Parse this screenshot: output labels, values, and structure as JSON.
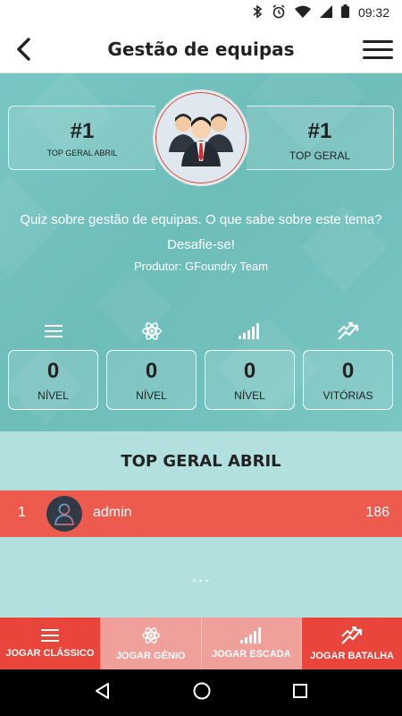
{
  "status_bar": {
    "time": "09:32",
    "icons": [
      "bluetooth-icon",
      "alarm-icon",
      "wifi-icon",
      "signal-icon",
      "battery-icon"
    ]
  },
  "app_bar": {
    "title": "Gestão de equipas",
    "back_icon": "back-arrow-icon",
    "menu_icon": "hamburger-menu-icon"
  },
  "quiz": {
    "rank_month": {
      "value": "#1",
      "label": "TOP GERAL ABRIL"
    },
    "rank_overall": {
      "value": "#1",
      "label": "TOP GERAL"
    },
    "avatar_icon": "team-people-icon",
    "description": "Quiz sobre gestão de equipas. O que sabe sobre este tema? Desafie-se!",
    "producer": "Produtor: GFoundry Team"
  },
  "stats": [
    {
      "icon": "list-icon",
      "value": "0",
      "label": "NÍVEL"
    },
    {
      "icon": "atom-icon",
      "value": "0",
      "label": "NÍVEL"
    },
    {
      "icon": "staircase-bars-icon",
      "value": "0",
      "label": "NÍVEL"
    },
    {
      "icon": "trending-arrows-icon",
      "value": "0",
      "label": "VITÓRIAS"
    }
  ],
  "leaderboard": {
    "title": "TOP GERAL ABRIL",
    "rows": [
      {
        "position": "1",
        "name": "admin",
        "score": "186",
        "avatar_icon": "user-avatar-icon"
      }
    ],
    "more": "..."
  },
  "bottom_nav": [
    {
      "icon": "list-icon",
      "label": "JOGAR CLÁSSICO",
      "state": "active"
    },
    {
      "icon": "atom-icon",
      "label": "JOGAR GÉNIO",
      "state": "disabled"
    },
    {
      "icon": "staircase-bars-icon",
      "label": "JOGAR ESCADA",
      "state": "disabled"
    },
    {
      "icon": "trending-arrows-icon",
      "label": "JOGAR BATALHA",
      "state": "active"
    }
  ],
  "system_nav": [
    "back-triangle-icon",
    "home-circle-icon",
    "recents-square-icon"
  ],
  "colors": {
    "accent_red": "#e9453b",
    "teal_background": "#6fc1be",
    "light_teal": "#b2e0df",
    "disabled_red": "#f0a09a"
  }
}
